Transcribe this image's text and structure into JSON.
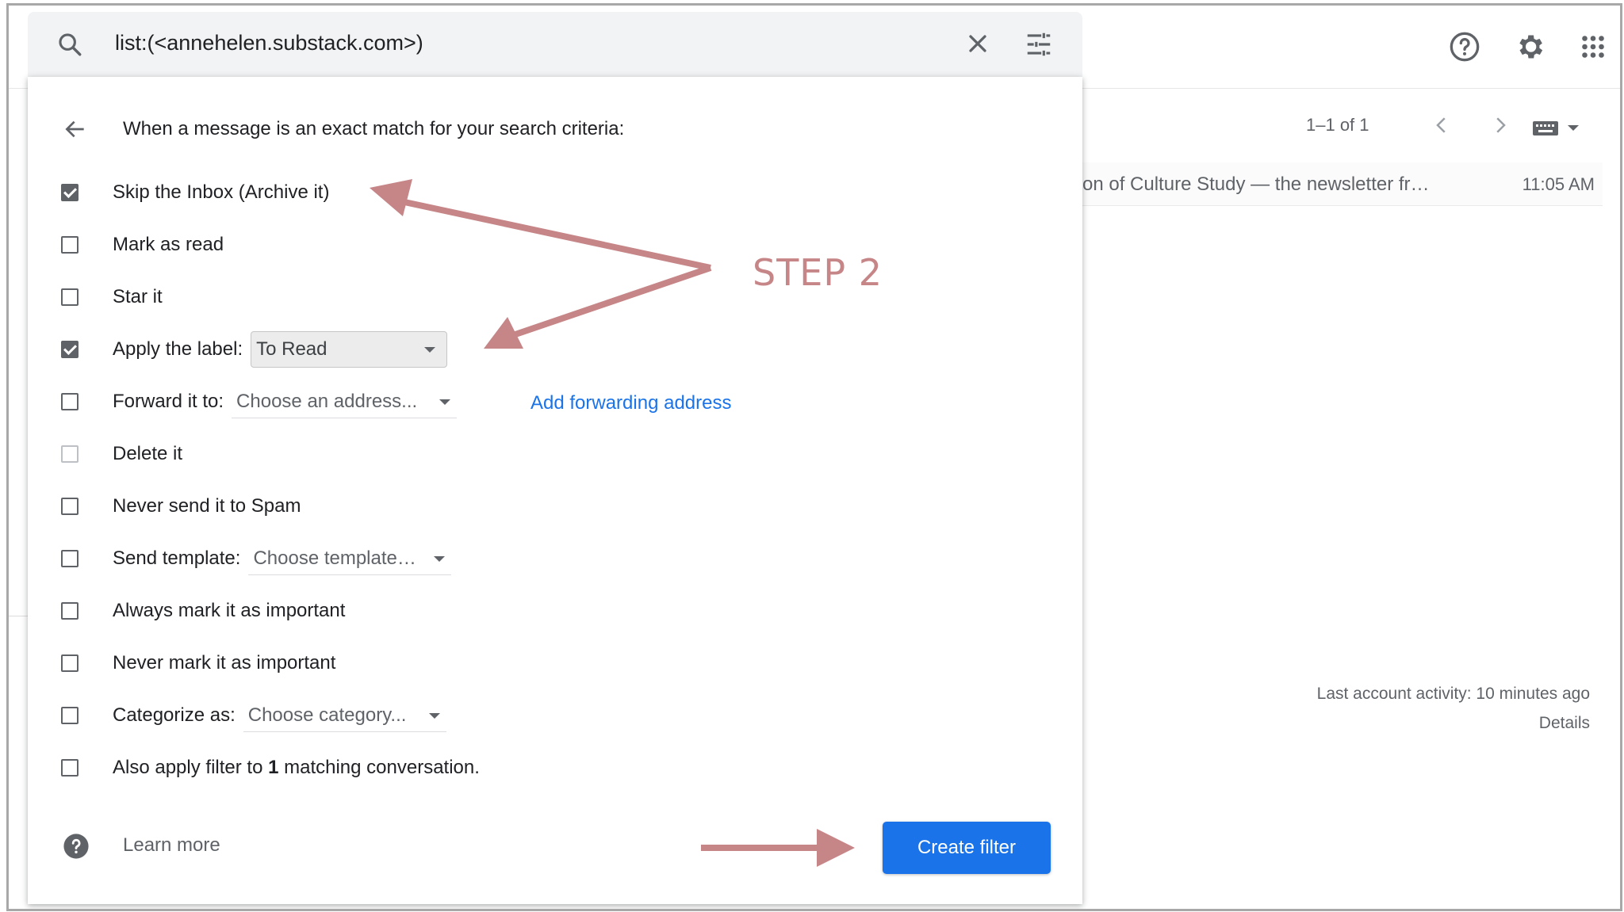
{
  "search": {
    "query": "list:(<annehelen.substack.com>)"
  },
  "header": {
    "icons": [
      "help-icon",
      "gear-icon",
      "apps-grid-icon"
    ]
  },
  "pager": {
    "range_text": "1–1 of 1"
  },
  "email": {
    "snippet": "on of Culture Study — the newsletter fr…",
    "time": "11:05 AM"
  },
  "activity": {
    "last_activity": "Last account activity: 10 minutes ago",
    "details": "Details"
  },
  "dialog": {
    "criteria_text": "When a message is an exact match for your search criteria:",
    "options": [
      {
        "label": "Skip the Inbox (Archive it)",
        "checked": true
      },
      {
        "label": "Mark as read",
        "checked": false
      },
      {
        "label": "Star it",
        "checked": false
      },
      {
        "label": "Apply the label:",
        "checked": true,
        "select_value": "To Read"
      },
      {
        "label": "Forward it to:",
        "checked": false,
        "select_value": "Choose an address...",
        "link": "Add forwarding address"
      },
      {
        "label": "Delete it",
        "checked": false
      },
      {
        "label": "Never send it to Spam",
        "checked": false
      },
      {
        "label": "Send template:",
        "checked": false,
        "select_value": "Choose template…"
      },
      {
        "label": "Always mark it as important",
        "checked": false
      },
      {
        "label": "Never mark it as important",
        "checked": false
      },
      {
        "label": "Categorize as:",
        "checked": false,
        "select_value": "Choose category..."
      },
      {
        "label_pre": "Also apply filter to ",
        "label_bold": "1",
        "label_post": " matching conversation.",
        "checked": false
      }
    ],
    "learn_more": "Learn more",
    "create_button": "Create filter"
  },
  "annotation": {
    "step_label": "STEP 2",
    "color": "#c68587"
  },
  "colors": {
    "accent": "#1a73e8",
    "checkbox": "#5f6368"
  }
}
